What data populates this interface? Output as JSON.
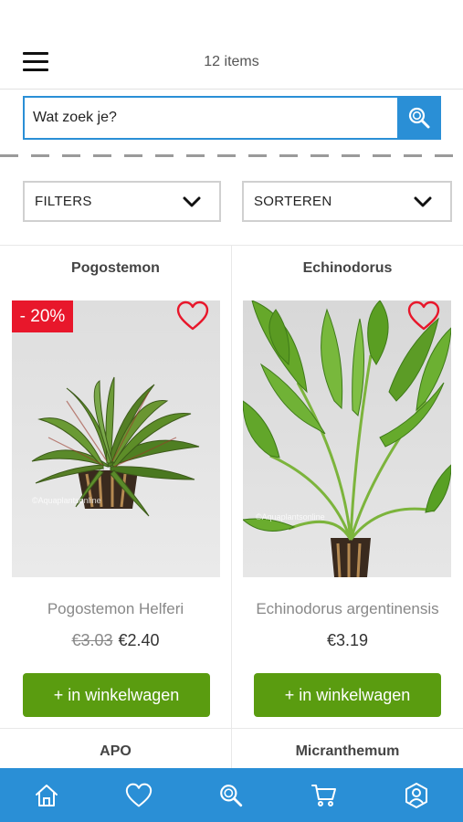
{
  "header": {
    "items_count": "12 items"
  },
  "search": {
    "placeholder": "Wat zoek je?"
  },
  "filters": {
    "filters_label": "FILTERS",
    "sort_label": "SORTEREN"
  },
  "products": [
    {
      "brand": "Pogostemon",
      "name": "Pogostemon Helferi",
      "discount_badge": "- 20%",
      "old_price": "€3.03",
      "price": "€2.40",
      "cart_label": "+ in winkelwagen",
      "watermark": "©Aquaplantsonline"
    },
    {
      "brand": "Echinodorus",
      "name": "Echinodorus argentinensis",
      "price": "€3.19",
      "cart_label": "+ in winkelwagen",
      "watermark": "©Aquaplantsonline"
    }
  ],
  "next_row": {
    "left_brand": "APO",
    "right_brand": "Micranthemum"
  },
  "nav": {
    "items": [
      "home-icon",
      "heart-icon",
      "search-icon",
      "cart-icon",
      "account-icon"
    ]
  },
  "colors": {
    "accent": "#2a8fd6",
    "cart_button": "#5a9c10",
    "discount": "#e8172b",
    "heart": "#e8172b"
  }
}
